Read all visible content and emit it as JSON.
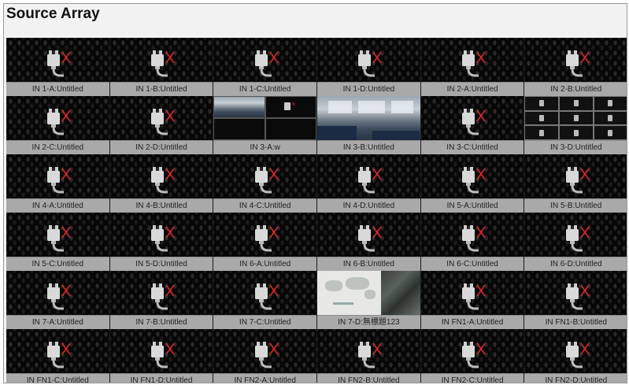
{
  "window": {
    "title": "Source Array"
  },
  "tiles": [
    {
      "label": "IN 1-A:Untitled",
      "kind": "nosignal"
    },
    {
      "label": "IN 1-B:Untitled",
      "kind": "nosignal"
    },
    {
      "label": "IN 1-C:Untitled",
      "kind": "nosignal"
    },
    {
      "label": "IN 1-D:Untitled",
      "kind": "nosignal"
    },
    {
      "label": "IN 2-A:Untitled",
      "kind": "nosignal"
    },
    {
      "label": "IN 2-B:Untitled",
      "kind": "nosignal"
    },
    {
      "label": "IN 2-C:Untitled",
      "kind": "nosignal"
    },
    {
      "label": "IN 2-D:Untitled",
      "kind": "nosignal"
    },
    {
      "label": "IN 3-A:w",
      "kind": "split4"
    },
    {
      "label": "IN 3-B:Untitled",
      "kind": "office"
    },
    {
      "label": "IN 3-C:Untitled",
      "kind": "nosignal"
    },
    {
      "label": "IN 3-D:Untitled",
      "kind": "split9"
    },
    {
      "label": "IN 4-A:Untitled",
      "kind": "nosignal"
    },
    {
      "label": "IN 4-B:Untitled",
      "kind": "nosignal"
    },
    {
      "label": "IN 4-C:Untitled",
      "kind": "nosignal"
    },
    {
      "label": "IN 4-D:Untitled",
      "kind": "nosignal"
    },
    {
      "label": "IN 5-A:Untitled",
      "kind": "nosignal"
    },
    {
      "label": "IN 5-B:Untitled",
      "kind": "nosignal"
    },
    {
      "label": "IN 5-C:Untitled",
      "kind": "nosignal"
    },
    {
      "label": "IN 5-D:Untitled",
      "kind": "nosignal"
    },
    {
      "label": "IN 6-A:Untitled",
      "kind": "nosignal"
    },
    {
      "label": "IN 6-B:Untitled",
      "kind": "nosignal"
    },
    {
      "label": "IN 6-C:Untitled",
      "kind": "nosignal"
    },
    {
      "label": "IN 6-D:Untitled",
      "kind": "nosignal"
    },
    {
      "label": "IN 7-A:Untitled",
      "kind": "nosignal"
    },
    {
      "label": "IN 7-B:Untitled",
      "kind": "nosignal"
    },
    {
      "label": "IN 7-C:Untitled",
      "kind": "nosignal"
    },
    {
      "label": "IN 7-D:無標題123",
      "kind": "map"
    },
    {
      "label": "IN FN1-A:Untitled",
      "kind": "nosignal"
    },
    {
      "label": "IN FN1-B:Untitled",
      "kind": "nosignal"
    },
    {
      "label": "IN FN1-C:Untitled",
      "kind": "nosignal"
    },
    {
      "label": "IN FN1-D:Untitled",
      "kind": "nosignal"
    },
    {
      "label": "IN FN2-A:Untitled",
      "kind": "nosignal"
    },
    {
      "label": "IN FN2-B:Untitled",
      "kind": "nosignal"
    },
    {
      "label": "IN FN2-C:Untitled",
      "kind": "nosignal"
    },
    {
      "label": "IN FN2-D:Untitled",
      "kind": "nosignal"
    }
  ],
  "icons": {
    "no_signal": "unplugged-cable-icon"
  },
  "colors": {
    "cross": "#d62828",
    "label_bg": "#a9a9a9",
    "tile_bg": "#060606"
  }
}
